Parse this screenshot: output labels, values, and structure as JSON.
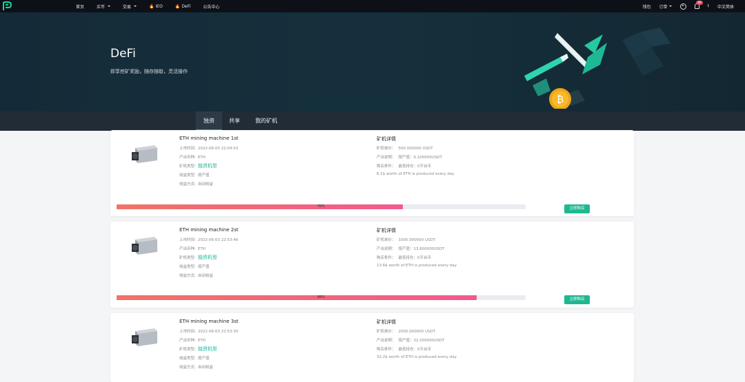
{
  "nav": {
    "items": [
      {
        "label": "首页",
        "has_caret": false
      },
      {
        "label": "买币",
        "has_caret": true
      },
      {
        "label": "交易",
        "has_caret": true
      },
      {
        "label": "IEO",
        "has_caret": false,
        "icon": "fire-icon"
      },
      {
        "label": "DeFi",
        "has_caret": false,
        "icon": "fire-icon"
      },
      {
        "label": "公告中心",
        "has_caret": false
      }
    ],
    "right": {
      "wallet": "钱包",
      "orders": "订单",
      "notification_count": "99",
      "language": "中文简体"
    }
  },
  "hero": {
    "title": "DeFi",
    "subtitle": "即享挖矿奖励，随存随取，灵活操作"
  },
  "tabs": [
    {
      "label": "独资",
      "active": true
    },
    {
      "label": "共享",
      "active": false
    },
    {
      "label": "我的矿机",
      "active": false
    }
  ],
  "labels": {
    "listed_time": "上市时间:",
    "output_currency": "产出币种:",
    "machine_type": "矿机类型:",
    "income_type": "收益类型:",
    "income_method": "收益方式:",
    "detail_title": "矿机详情",
    "unit_price": "矿机单价：",
    "output_desc": "产出说明：",
    "purchase_cond": "购买条件：",
    "buy_button": "立即购买"
  },
  "machines": [
    {
      "name": "ETH mining machine 1st",
      "listed_time": "2022-06-03 22:04:03",
      "output_currency": "ETH",
      "machine_type": "独资机型",
      "income_type": "按产值",
      "income_method": "自动收益",
      "unit_price": "500.000000 USDT",
      "output_desc": "按产值：6.100000USDT",
      "purchase_cond": "最低持仓：0平台币",
      "note": "6.1$ worth of ETH is produced every day",
      "progress_label": "70%",
      "progress": 70
    },
    {
      "name": "ETH mining machine 2st",
      "listed_time": "2022-06-03 22:53:46",
      "output_currency": "ETH",
      "machine_type": "独资机型",
      "income_type": "按产值",
      "income_method": "自动收益",
      "unit_price": "1000.000000 USDT",
      "output_desc": "按产值：13.600000USDT",
      "purchase_cond": "最低持仓：0平台币",
      "note": "13.6$ worth of ETH is produced every day",
      "progress_label": "88%",
      "progress": 88
    },
    {
      "name": "ETH mining machine 3st",
      "listed_time": "2022-06-03 22:53:30",
      "output_currency": "ETH",
      "machine_type": "独资机型",
      "income_type": "按产值",
      "income_method": "自动收益",
      "unit_price": "2000.000000 USDT",
      "output_desc": "按产值：32.200000USDT",
      "purchase_cond": "最低持仓：0平台币",
      "note": "32.2$ worth of ETH is produced every day"
    }
  ],
  "colors": {
    "accent": "#19b89a",
    "progress_start": "#ef7466",
    "progress_end": "#f25a8e",
    "nav_bg": "#0d1117",
    "hero_bg": "#15303c"
  }
}
